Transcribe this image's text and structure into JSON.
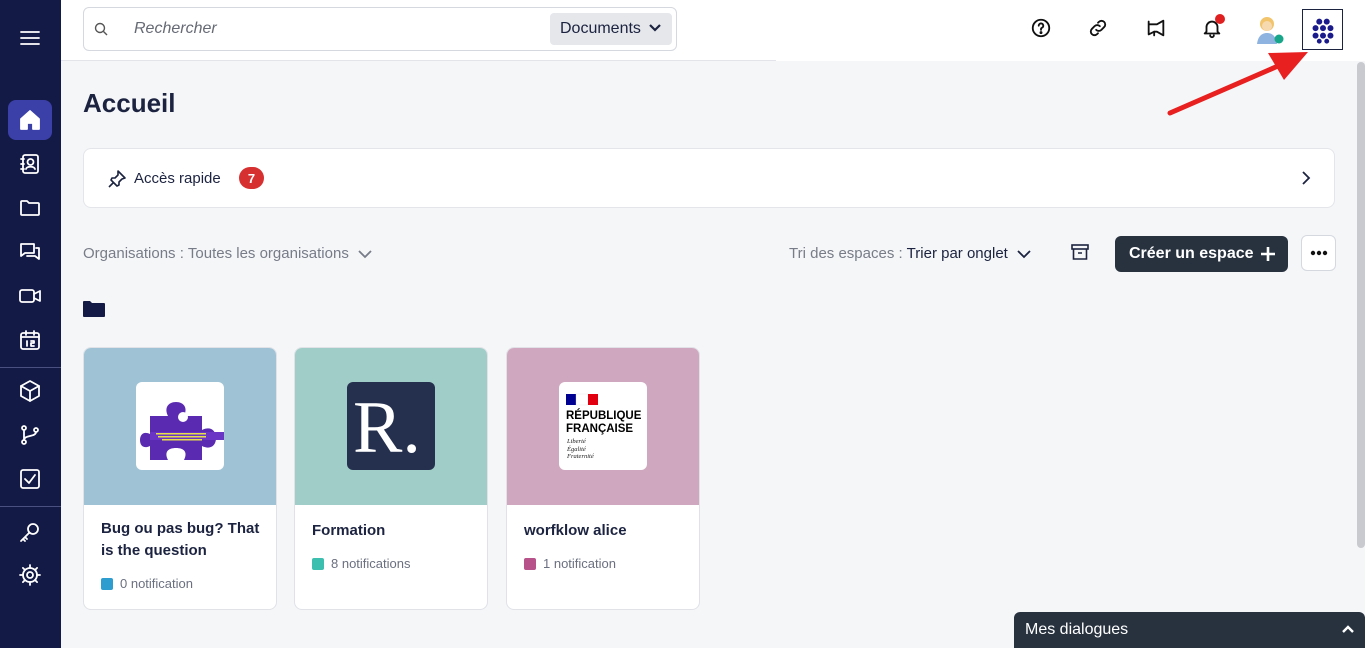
{
  "search": {
    "placeholder": "Rechercher",
    "scope": "Documents"
  },
  "page": {
    "title": "Accueil"
  },
  "quick_access": {
    "label": "Accès rapide",
    "count": "7"
  },
  "filters": {
    "org_label": "Organisations :",
    "org_value": "Toutes les organisations",
    "sort_label": "Tri des espaces :",
    "sort_value": "Trier par onglet"
  },
  "actions": {
    "create_label": "Créer un espace"
  },
  "cards": [
    {
      "title": "Bug ou pas bug? That is the question",
      "notifications": "0 notification",
      "banner_color": "#9fc3d4",
      "dot_color": "#2d9ccf"
    },
    {
      "title": "Formation",
      "notifications": "8 notifications",
      "banner_color": "#a1cdc8",
      "dot_color": "#3dbfb0",
      "logo_letter": "R."
    },
    {
      "title": "worfklow alice",
      "notifications": "1 notification",
      "banner_color": "#cfa8bf",
      "dot_color": "#b8528a",
      "logo_lines": [
        "RÉPUBLIQUE",
        "FRANÇAISE"
      ],
      "logo_motto": [
        "Liberté",
        "Égalité",
        "Fraternité"
      ]
    }
  ],
  "dialogs": {
    "label": "Mes dialogues"
  },
  "colors": {
    "sidebar": "#131a46",
    "active": "#3b3fa8",
    "badge": "#d63030",
    "button": "#28323f"
  }
}
